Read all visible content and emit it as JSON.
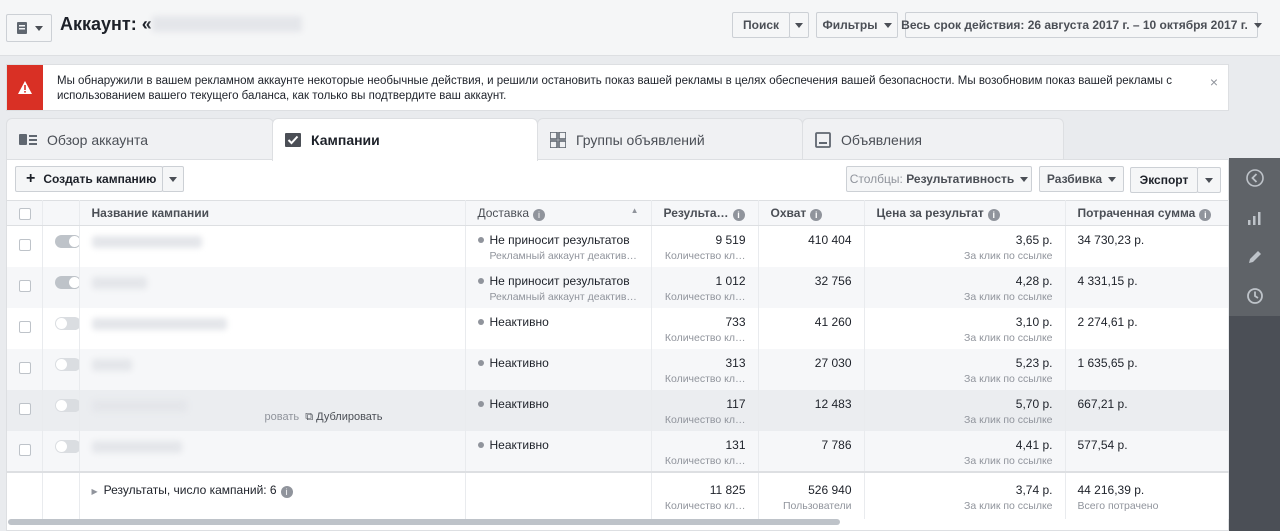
{
  "header": {
    "title": "Аккаунт: «",
    "search_label": "Поиск",
    "filters_label": "Фильтры",
    "date_range_label": "Весь срок действия: 26 августа 2017 г. – 10 октября 2017 г."
  },
  "alert": {
    "text": "Мы обнаружили в вашем рекламном аккаунте некоторые необычные действия, и решили остановить показ вашей рекламы в целях обеспечения вашей безопасности. Мы возобновим показ вашей рекламы с использованием вашего текущего баланса, как только вы подтвердите ваш аккаунт.",
    "close": "×"
  },
  "tabs": [
    "Обзор аккаунта",
    "Кампании",
    "Группы объявлений",
    "Объявления"
  ],
  "toolbar": {
    "create_label": "Создать кампанию",
    "columns_prefix": "Столбцы: ",
    "columns_value": "Результативность",
    "breakdown_label": "Разбивка",
    "export_label": "Экспорт"
  },
  "table": {
    "headers": [
      "Название кампании",
      "Доставка",
      "Результа…",
      "Охват",
      "Цена за результат",
      "Потраченная сумма"
    ],
    "rows": [
      {
        "delivery": "Не приносит результатов",
        "delivery_sub": "Рекламный аккаунт деактив…",
        "results": "9 519",
        "results_sub": "Количество кл…",
        "reach": "410 404",
        "cpr": "3,65 р.",
        "cpr_sub": "За клик по ссылке",
        "spent": "34 730,23 р."
      },
      {
        "delivery": "Не приносит результатов",
        "delivery_sub": "Рекламный аккаунт деактив…",
        "results": "1 012",
        "results_sub": "Количество кл…",
        "reach": "32 756",
        "cpr": "4,28 р.",
        "cpr_sub": "За клик по ссылке",
        "spent": "4 331,15 р."
      },
      {
        "delivery": "Неактивно",
        "delivery_sub": "",
        "results": "733",
        "results_sub": "Количество кл…",
        "reach": "41 260",
        "cpr": "3,10 р.",
        "cpr_sub": "За клик по ссылке",
        "spent": "2 274,61 р."
      },
      {
        "delivery": "Неактивно",
        "delivery_sub": "",
        "results": "313",
        "results_sub": "Количество кл…",
        "reach": "27 030",
        "cpr": "5,23 р.",
        "cpr_sub": "За клик по ссылке",
        "spent": "1 635,65 р."
      },
      {
        "delivery": "Неактивно",
        "delivery_sub": "",
        "results": "117",
        "results_sub": "Количество кл…",
        "reach": "12 483",
        "cpr": "5,70 р.",
        "cpr_sub": "За клик по ссылке",
        "spent": "667,21 р."
      },
      {
        "delivery": "Неактивно",
        "delivery_sub": "",
        "results": "131",
        "results_sub": "Количество кл…",
        "reach": "7 786",
        "cpr": "4,41 р.",
        "cpr_sub": "За клик по ссылке",
        "spent": "577,54 р."
      }
    ],
    "row_actions": {
      "edit_fragment": "ровать",
      "duplicate": "Дублировать"
    },
    "footer": {
      "label": "Результаты, число кампаний: 6",
      "results": "11 825",
      "results_sub": "Количество кл…",
      "reach": "526 940",
      "reach_sub": "Пользователи",
      "cpr": "3,74 р.",
      "cpr_sub": "За клик по ссылке",
      "spent": "44 216,39 р.",
      "spent_sub": "Всего потрачено"
    }
  },
  "colors": {
    "alert": "#d93025",
    "sidebar": "#4b4f56"
  }
}
